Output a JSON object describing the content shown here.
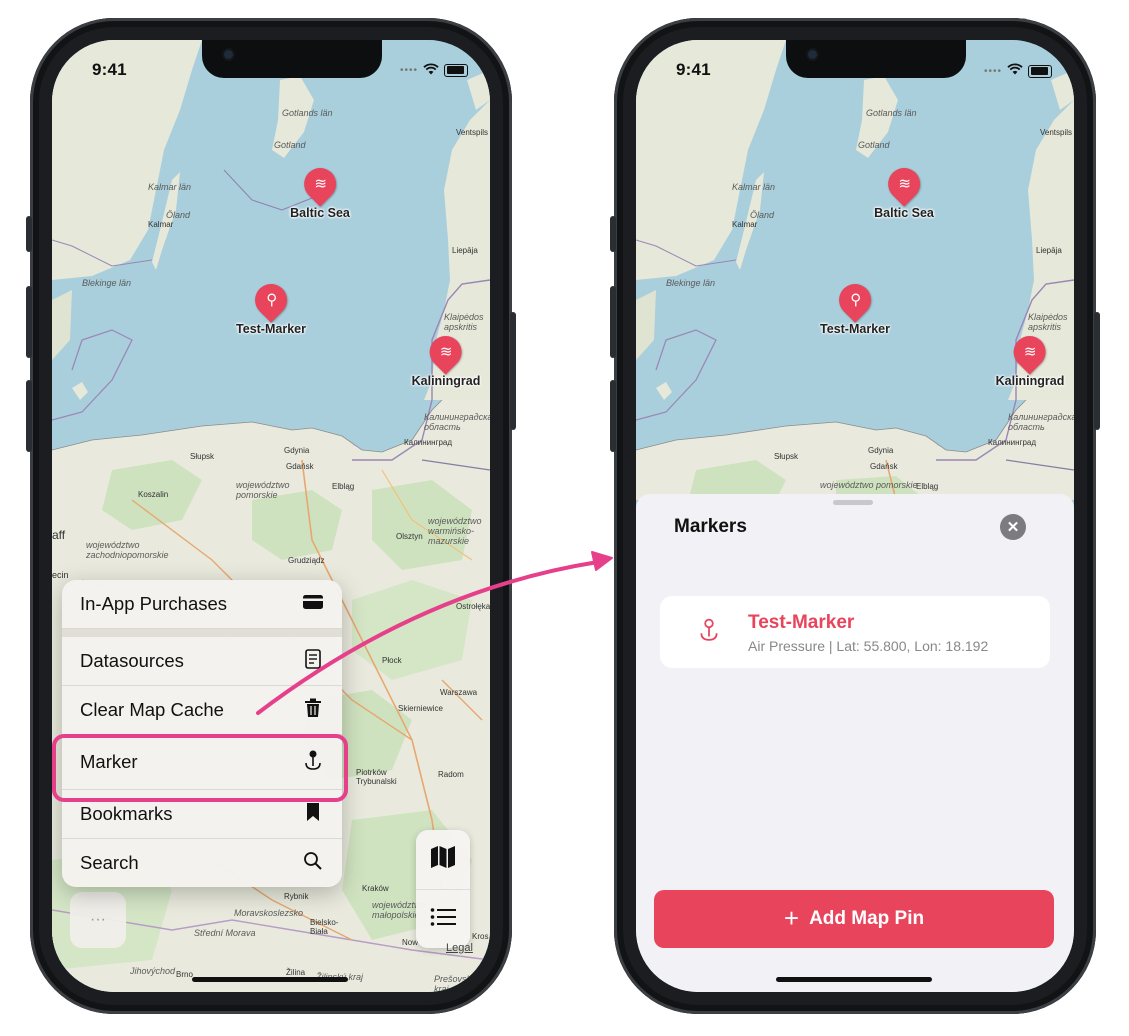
{
  "status_time": "9:41",
  "left_phone": {
    "map": {
      "pois": [
        {
          "label": "Baltic Sea",
          "icon": "waves-drop-icon"
        },
        {
          "label": "Test-Marker",
          "icon": "pin-marker-icon"
        },
        {
          "label": "Kaliningrad",
          "icon": "waves-drop-icon"
        }
      ],
      "labels": {
        "gotland_lan": "Gotlands län",
        "gotland": "Gotland",
        "kalmar_lan": "Kalmar län",
        "oland": "Öland",
        "kalmar": "Kalmar",
        "blekinge": "Blekinge län",
        "ventspils": "Ventspils",
        "liepaja": "Liepāja",
        "klaipeda": "Klaipėdos apskritis",
        "kaliningrad_oblast": "Калининградская область",
        "kaliningrad_ru": "Калининград",
        "slupsk": "Słupsk",
        "gdynia": "Gdynia",
        "gdansk": "Gdańsk",
        "koszalin": "Koszalin",
        "pomorskie": "województwo pomorskie",
        "elblag": "Elbląg",
        "warminsko": "województwo warmińsko-mazurskie",
        "olsztyn": "Olsztyn",
        "zachodnio": "województwo zachodniopomorskie",
        "grudziadz": "Grudziądz",
        "ostroleka": "Ostrołęka",
        "plock": "Płock",
        "warszawa": "Warszawa",
        "skierniewice": "Skierniewice",
        "piotrkow": "Piotrków Trybunalski",
        "radom": "Radom",
        "krakow": "Kraków",
        "rybnik": "Rybnik",
        "moravskoslezsko": "Moravskoslezsko",
        "bielsko": "Bielsko-Biała",
        "malopolskie": "województwo małopolskie",
        "stredni_morava": "Střední Morava",
        "jihovychod": "Jihovýchod",
        "brno": "Brno",
        "zilina": "Žilina",
        "presovsky": "Prešovský kraj",
        "zilinsky": "Žilinský kraj",
        "aff": "aff",
        "ecin": "ecin",
        "now": "Now",
        "kros": "Kros"
      }
    },
    "menu": {
      "items": [
        {
          "label": "In-App Purchases",
          "icon": "credit-card-icon",
          "glyph": "▬"
        },
        {
          "label": "Datasources",
          "icon": "document-icon",
          "glyph": "▤"
        },
        {
          "label": "Clear Map Cache",
          "icon": "trash-icon",
          "glyph": "🗑"
        },
        {
          "label": "Marker",
          "icon": "pin-marker-icon",
          "glyph": "⚲"
        },
        {
          "label": "Bookmarks",
          "icon": "bookmark-icon",
          "glyph": "🔖"
        },
        {
          "label": "Search",
          "icon": "search-icon",
          "glyph": "⌕"
        }
      ]
    },
    "more_button": "···",
    "map_controls": [
      "map-icon",
      "list-icon"
    ],
    "legal": "Legal"
  },
  "right_phone": {
    "sheet": {
      "title": "Markers",
      "close": "✕",
      "items": [
        {
          "name": "Test-Marker",
          "detail": "Air Pressure | Lat: 55.800, Lon: 18.192"
        }
      ],
      "add_button": "Add Map Pin",
      "add_plus": "+"
    }
  },
  "colors": {
    "accent": "#e8445c",
    "highlight": "#e6408a",
    "sea": "#a9cedc",
    "land": "#e9eadd"
  }
}
